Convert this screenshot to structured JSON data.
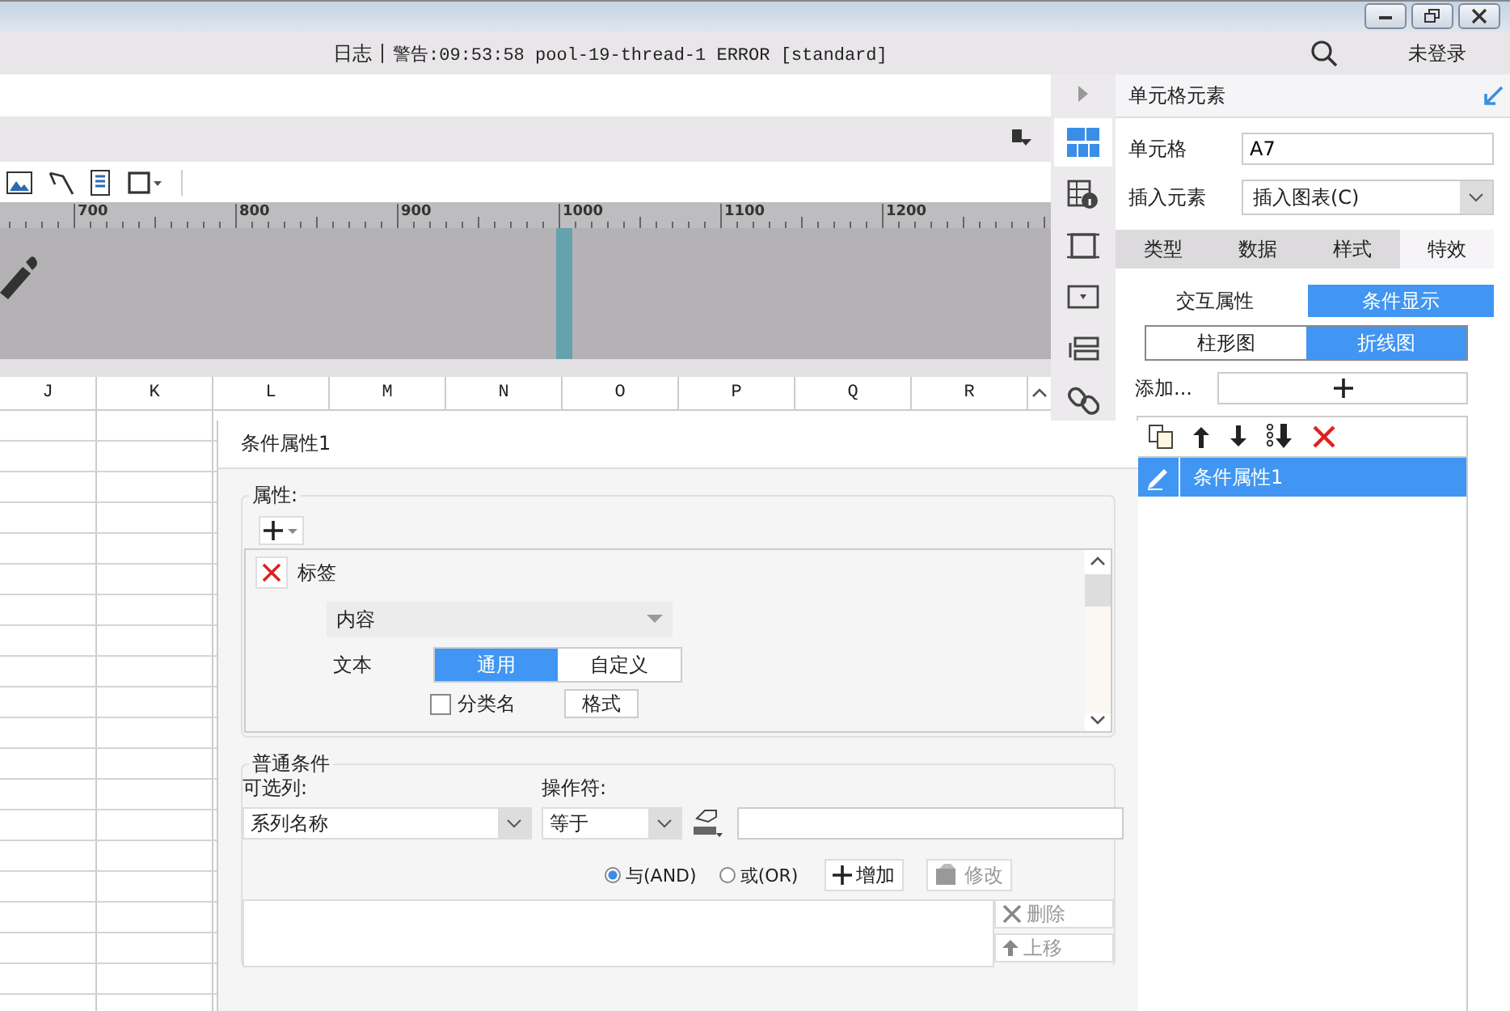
{
  "top_bar": {
    "log_label": "日志",
    "log_message": "警告:09:53:58 pool-19-thread-1 ERROR [standard]",
    "login": "未登录"
  },
  "ruler": {
    "ticks": [
      "700",
      "800",
      "900",
      "1000",
      "1100",
      "1200"
    ]
  },
  "sheet": {
    "columns": [
      "J",
      "K",
      "L",
      "M",
      "N",
      "O",
      "P",
      "Q",
      "R"
    ]
  },
  "side_tabs": [
    {
      "selected": true
    },
    {
      "selected": false
    },
    {
      "selected": false
    },
    {
      "selected": false
    },
    {
      "selected": false
    },
    {
      "selected": false
    }
  ],
  "panel": {
    "title": "单元格元素",
    "cell_label": "单元格",
    "cell_value": "A7",
    "insert_label": "插入元素",
    "insert_value": "插入图表(C)",
    "tabs": [
      {
        "label": "类型",
        "selected": false
      },
      {
        "label": "数据",
        "selected": false
      },
      {
        "label": "样式",
        "selected": false
      },
      {
        "label": "特效",
        "selected": true
      }
    ],
    "subtabs": [
      {
        "label": "交互属性",
        "selected": false
      },
      {
        "label": "条件显示",
        "selected": true
      }
    ],
    "chart_tabs": [
      {
        "label": "柱形图",
        "selected": false
      },
      {
        "label": "折线图",
        "selected": true
      }
    ],
    "add_label": "添加...",
    "items": [
      {
        "label": "条件属性1",
        "selected": true
      }
    ]
  },
  "dialog": {
    "title": "条件属性1",
    "attr_legend": "属性:",
    "label_name": "标签",
    "content_select": "内容",
    "text_label": "文本",
    "text_options": [
      {
        "label": "通用",
        "selected": true
      },
      {
        "label": "自定义",
        "selected": false
      }
    ],
    "category_checkbox": {
      "label": "分类名",
      "checked": false
    },
    "format_button": "格式",
    "cond_legend": "普通条件",
    "column_label": "可选列:",
    "column_value": "系列名称",
    "operator_label": "操作符:",
    "operator_value": "等于",
    "logic": [
      {
        "label": "与(AND)",
        "selected": true
      },
      {
        "label": "或(OR)",
        "selected": false
      }
    ],
    "add_button": "增加",
    "edit_button": {
      "label": "修改",
      "disabled": true
    },
    "delete_button": {
      "label": "删除",
      "disabled": true
    },
    "up_button": {
      "label": "上移",
      "disabled": true
    }
  }
}
